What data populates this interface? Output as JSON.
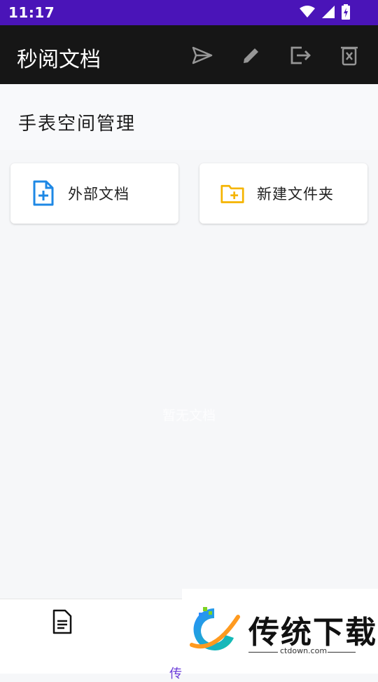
{
  "status": {
    "time": "11:17"
  },
  "appbar": {
    "title": "秒阅文档",
    "actions": [
      {
        "icon": "send-icon"
      },
      {
        "icon": "edit-icon"
      },
      {
        "icon": "export-icon"
      },
      {
        "icon": "delete-icon"
      }
    ]
  },
  "section": {
    "title": "手表空间管理"
  },
  "cards": [
    {
      "label": "外部文档",
      "icon": "add-file-icon",
      "color": "#1e88e5"
    },
    {
      "label": "新建文件夹",
      "icon": "add-folder-icon",
      "color": "#f5b400"
    }
  ],
  "empty_text": "暂无文档",
  "bottom_nav": {
    "docs_icon": "document-icon",
    "partial_label": "传"
  },
  "watermark": {
    "brand": "传统下载",
    "domain": "ctdown.com"
  },
  "colors": {
    "status_bar": "#4a14b8",
    "app_bar": "#161616",
    "accent": "#6a3bd8"
  }
}
